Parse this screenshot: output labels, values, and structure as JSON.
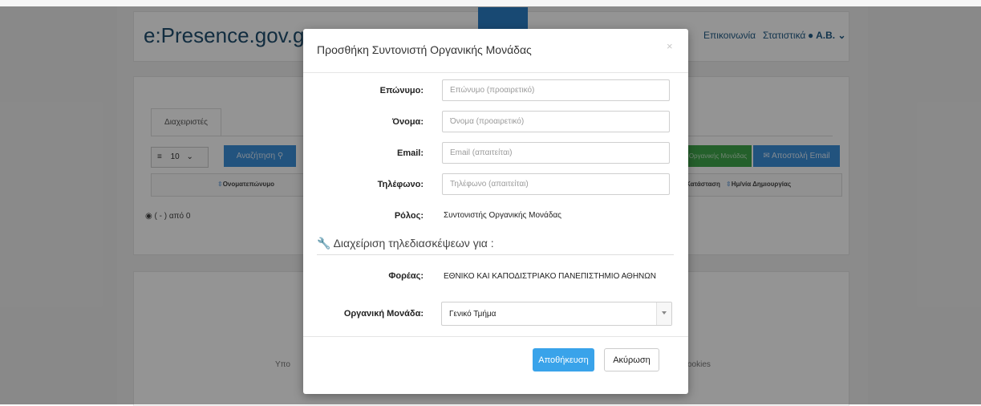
{
  "app": {
    "brand": "e:Presence.gov.gr",
    "nav": {
      "contact_label": "Επικοινωνία",
      "stats_label": "Στατιστικά",
      "user_label": "Α.Β."
    }
  },
  "background": {
    "tab_label": "Διαχειριστές",
    "per_page": "10",
    "search_button": "Αναζήτηση",
    "org_unit_button": "Οργανικής Μονάδας",
    "email_button": "Αποστολή Email",
    "columns": [
      "Ονοματεπώνυμο",
      "Κατάσταση",
      "Ημ/νία Δημιουργίας"
    ],
    "count_text": "( - ) από 0",
    "footer_left": "Υπο",
    "footer_right": "ookies"
  },
  "modal": {
    "title": "Προσθήκη Συντονιστή Οργανικής Μονάδας",
    "close_symbol": "×",
    "fields": {
      "surname": {
        "label": "Επώνυμο:",
        "placeholder": "Επώνυμο (προαιρετικό)",
        "value": ""
      },
      "name": {
        "label": "Όνομα:",
        "placeholder": "Όνομα (προαιρετικό)",
        "value": ""
      },
      "email": {
        "label": "Email:",
        "placeholder": "Email (απαιτείται)",
        "value": ""
      },
      "phone": {
        "label": "Τηλέφωνο:",
        "placeholder": "Τηλέφωνο (απαιτείται)",
        "value": ""
      }
    },
    "role": {
      "label": "Ρόλος:",
      "value": "Συντονιστής Οργανικής Μονάδας"
    },
    "section_title": "Διαχείριση τηλεδιασκέψεων για :",
    "institution": {
      "label": "Φορέας:",
      "value": "ΕΘΝΙΚΟ ΚΑΙ ΚΑΠΟΔΙΣΤΡΙΑΚΟ ΠΑΝΕΠΙΣΤΗΜΙΟ ΑΘΗΝΩΝ"
    },
    "org_unit": {
      "label": "Οργανική Μονάδα:",
      "selected": "Γενικό Τμήμα"
    },
    "save_label": "Αποθήκευση",
    "cancel_label": "Ακύρωση"
  },
  "colors": {
    "primary": "#39a3ea",
    "brand": "#1f4e6f",
    "success": "#3ea64a"
  },
  "icons": [
    "wrench-icon",
    "eye-icon",
    "search-icon",
    "envelope-icon",
    "list-icon",
    "user-icon",
    "chevron-down-icon",
    "close-icon"
  ]
}
